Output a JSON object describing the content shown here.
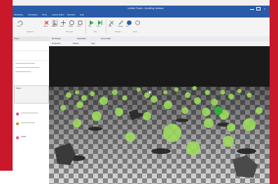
{
  "window": {
    "title": "Untitled Project - Modelling Software"
  },
  "menu": {
    "items": [
      "Modelling",
      "Simulation",
      "Tools",
      "Assets Editor",
      "Modules",
      "Help"
    ]
  },
  "ribbon": {
    "groups": [
      "Clipboard",
      "Placement",
      "Play",
      "Navigate",
      "Extras"
    ],
    "buttons": [
      "Undo",
      "Delete",
      "Select",
      "Move",
      "Rotate",
      "Scale",
      "Play",
      "Stop",
      "Path",
      "Settings",
      "Info"
    ]
  },
  "document_tabs": [
    "3D Viewport",
    "Node Editor",
    "Scene Graph"
  ],
  "toolbar2": {
    "items": [
      "Perspective",
      "Shaded",
      "Snap"
    ]
  },
  "left_panel": {
    "items": [
      "Project",
      "Scene",
      "Assets"
    ]
  },
  "colors": {
    "frame": "#c8182a",
    "titlebar": "#2a5ba8",
    "sphere": "#9fe25c",
    "floor_light": "#d9d9d9",
    "floor_dark": "#7b7b7b",
    "sky": "#1a1a1a"
  }
}
